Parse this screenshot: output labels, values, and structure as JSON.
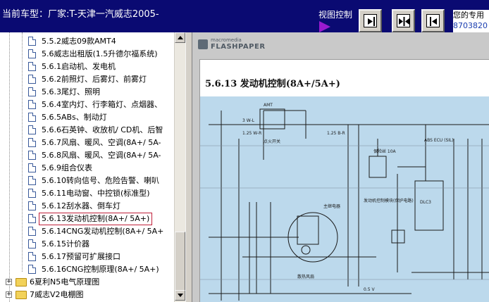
{
  "header": {
    "title": "当前车型：厂家:T-天津一汽威志2005-",
    "view_control_label": "视图控制",
    "buttons": [
      "single-page-view",
      "two-page-view",
      "previous-page"
    ],
    "info_text": "您的专用",
    "info_number": "8703820"
  },
  "tree": {
    "items": [
      {
        "label": "5.5.2威志09款AMT4"
      },
      {
        "label": "5.6威志出租版(1.5升德尔福系统)"
      },
      {
        "label": "5.6.1启动机、发电机"
      },
      {
        "label": "5.6.2前照灯、后雾灯、前雾灯"
      },
      {
        "label": "5.6.3尾灯、照明"
      },
      {
        "label": "5.6.4室内灯、行李箱灯、点烟器、"
      },
      {
        "label": "5.6.5ABs、制动灯"
      },
      {
        "label": "5.6.6石英钟、收放机/ CD机、后智"
      },
      {
        "label": "5.6.7风扇、暖风、空调(8A+/ 5A-"
      },
      {
        "label": "5.6.8风扇、暖风、空调(8A+/ 5A-"
      },
      {
        "label": "5.6.9组合仪表"
      },
      {
        "label": "5.6.10转向信号、危险告警、喇叭"
      },
      {
        "label": "5.6.11电动窗、中控锁(标准型)"
      },
      {
        "label": "5.6.12刮水器、倒车灯"
      },
      {
        "label": "5.6.13发动机控制(8A+/ 5A+)"
      },
      {
        "label": "5.6.14CNG发动机控制(8A+/ 5A+"
      },
      {
        "label": "5.6.15计价器"
      },
      {
        "label": "5.6.17预留可扩展接口"
      },
      {
        "label": "5.6.16CNG控制原理(8A+/ 5A+)"
      }
    ],
    "folders": [
      {
        "label": "6夏利N5电气原理图",
        "expand": "+"
      },
      {
        "label": "7威志V2电棚图",
        "expand": "+"
      }
    ],
    "selected_index": 14
  },
  "viewer": {
    "logo_small": "macromedia",
    "logo_big": "FLASHPAPER",
    "page_heading": "5.6.13  发动机控制(8A+/5A+)",
    "schematic_labels": {
      "amt": "AMT",
      "switch": "点火开关",
      "fuse": "保险丝 10A",
      "abs": "ABS ECU (SIL)",
      "dlc": "DLC3",
      "ecu_note": "发动机控制模块(保护电路)",
      "relay": "主继电器",
      "fan": "散热风扇",
      "wire_1": "3 W-L",
      "wire_2": "1.25 W-R",
      "wire_3": "1.25 B-R",
      "wire_4": "0.5 V"
    }
  },
  "colors": {
    "header_bg": "#0a0a72",
    "view_arrow": "#9a1ad0",
    "selection_border": "#c0203a",
    "schematic_bg": "#bcd9ec"
  }
}
